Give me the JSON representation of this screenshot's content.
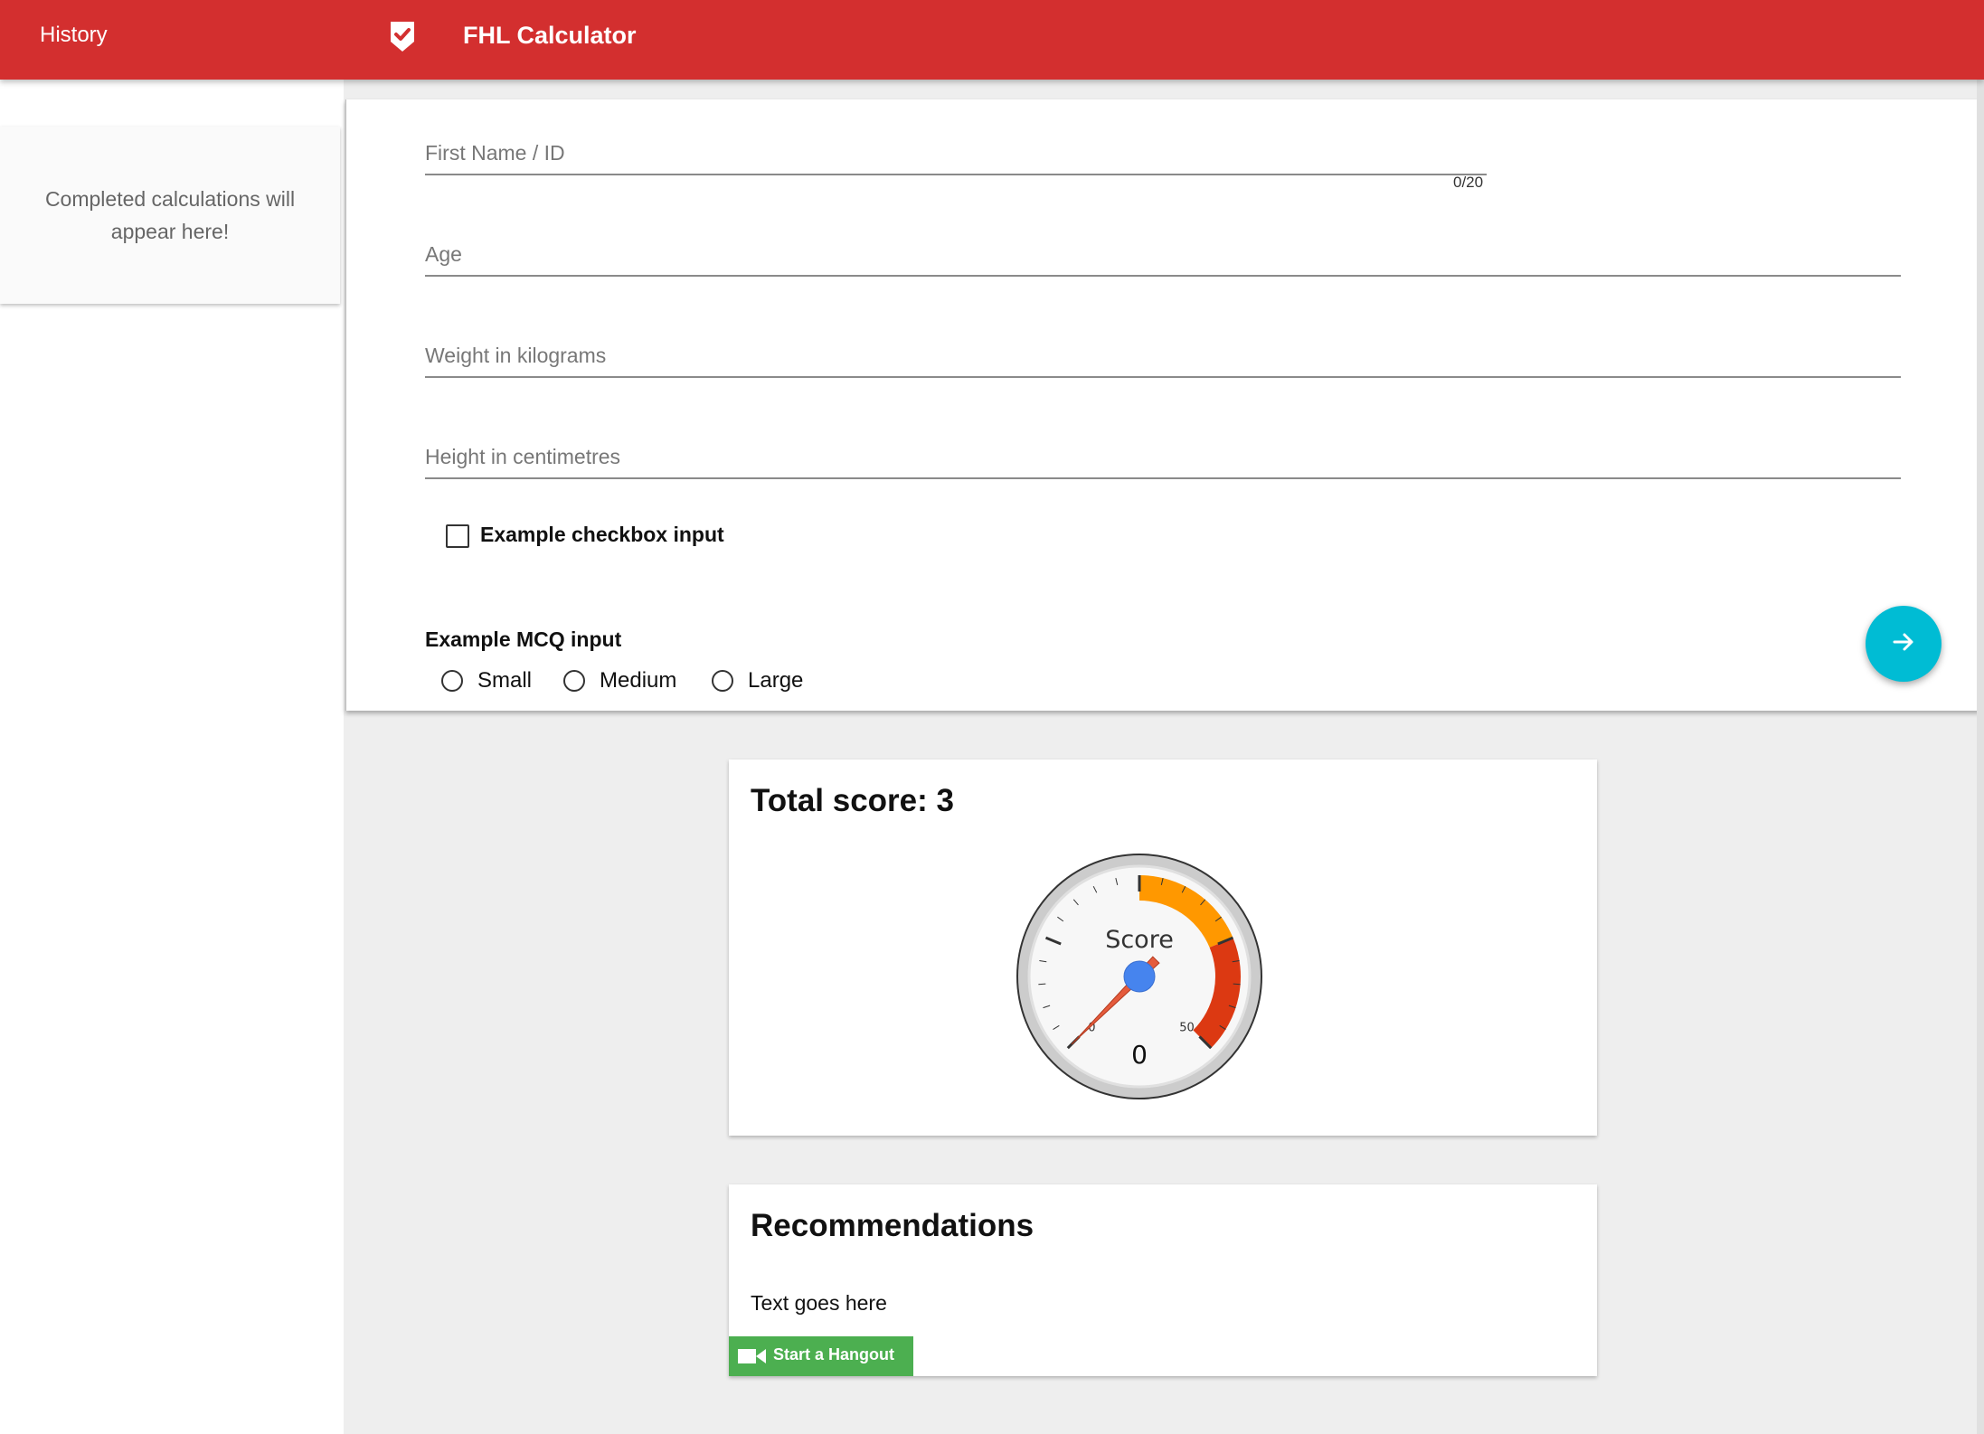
{
  "header": {
    "history_title": "History",
    "app_icon": "shield-check-icon",
    "app_title": "FHL Calculator",
    "bg_color": "#d32f2f"
  },
  "sidebar": {
    "empty_message": "Completed calculations will appear here!"
  },
  "form": {
    "fields": [
      {
        "label": "First Name / ID",
        "counter": "0/20",
        "value": ""
      },
      {
        "label": "Age",
        "value": ""
      },
      {
        "label": "Weight in kilograms",
        "value": ""
      },
      {
        "label": "Height in centimetres",
        "value": ""
      }
    ],
    "checkbox": {
      "label": "Example checkbox input",
      "checked": false
    },
    "mcq": {
      "title": "Example MCQ input",
      "options": [
        "Small",
        "Medium",
        "Large"
      ],
      "selected": null
    },
    "submit_icon": "arrow-right-icon",
    "submit_color": "#00bcd4"
  },
  "score_card": {
    "title": "Total score: 3",
    "gauge": {
      "label": "Score",
      "value": 0,
      "value_text": "0",
      "min": 0,
      "max": 50,
      "min_label": "0",
      "max_label": "50",
      "colors": {
        "yellow": "#ff9800",
        "red": "#dc3912",
        "needle": "#e55b3c",
        "hub": "#4684ee"
      }
    }
  },
  "recommendations": {
    "title": "Recommendations",
    "text": "Text goes here",
    "hangout_label": "Start a Hangout",
    "hangout_icon": "video-camera-icon",
    "hangout_color": "#4caf50"
  }
}
